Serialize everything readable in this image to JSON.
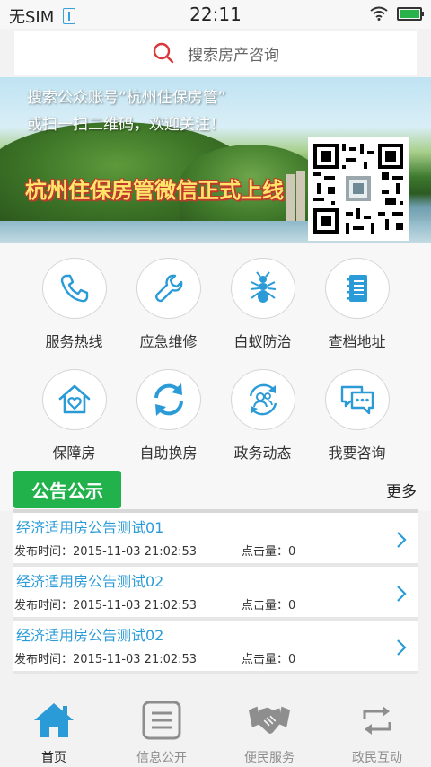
{
  "status_bar": {
    "carrier": "无SIM",
    "time": "22:11",
    "battery_level_percent": 100
  },
  "search": {
    "placeholder": "搜索房产咨询",
    "icon": "search-icon"
  },
  "banner": {
    "line1": "搜索公众账号“杭州住保房管”",
    "line2": "或扫一扫二维码，欢迎关注！",
    "title": "杭州住保房管微信正式上线"
  },
  "grid": [
    {
      "label": "服务热线",
      "icon": "phone-icon"
    },
    {
      "label": "应急维修",
      "icon": "wrench-icon"
    },
    {
      "label": "白蚁防治",
      "icon": "ant-icon"
    },
    {
      "label": "查档地址",
      "icon": "notebook-icon"
    },
    {
      "label": "保障房",
      "icon": "house-heart-icon"
    },
    {
      "label": "自助换房",
      "icon": "refresh-icon"
    },
    {
      "label": "政务动态",
      "icon": "people-cycle-icon"
    },
    {
      "label": "我要咨询",
      "icon": "chat-icon"
    }
  ],
  "notice": {
    "tag": "公告公示",
    "more": "更多",
    "items": [
      {
        "title": "经济适用房公告测试01",
        "time": "发布时间：2015-11-03 21:02:53",
        "clicks": "点击量：0"
      },
      {
        "title": "经济适用房公告测试02",
        "time": "发布时间：2015-11-03 21:02:53",
        "clicks": "点击量：0"
      },
      {
        "title": "经济适用房公告测试02",
        "time": "发布时间：2015-11-03 21:02:53",
        "clicks": "点击量：0"
      }
    ]
  },
  "tabbar": [
    {
      "label": "首页",
      "icon": "home-icon",
      "active": true
    },
    {
      "label": "信息公开",
      "icon": "document-icon",
      "active": false
    },
    {
      "label": "便民服务",
      "icon": "handshake-icon",
      "active": false
    },
    {
      "label": "政民互动",
      "icon": "exchange-icon",
      "active": false
    }
  ],
  "colors": {
    "accent_blue": "#2a9bd7",
    "tag_green": "#22b24c",
    "battery_green": "#2ab24a",
    "search_red": "#d9373b"
  }
}
